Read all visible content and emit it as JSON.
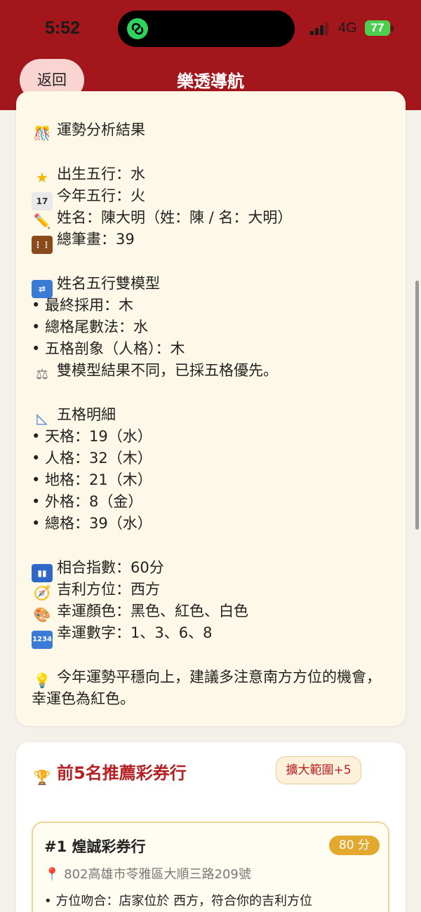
{
  "status": {
    "time": "5:52",
    "network": "4G",
    "battery": "77"
  },
  "nav": {
    "back_label": "返回",
    "title": "樂透導航"
  },
  "fortune": {
    "heading": "運勢分析結果",
    "birth_element": "出生五行：水",
    "year_element": "今年五行：火",
    "name_line": "姓名：陳大明（姓：陳 / 名：大明）",
    "total_strokes": "總筆畫：39",
    "dual_model_heading": "姓名五行雙模型",
    "final_adopted": "• 最終採用：木",
    "tail_method": "• 總格尾數法：水",
    "five_grid_person": "• 五格剖象（人格）：木",
    "dual_note": "雙模型結果不同，已採五格優先。",
    "five_grid_heading": "五格明細",
    "grid_items": [
      "• 天格：19（水）",
      "• 人格：32（木）",
      "• 地格：21（木）",
      "• 外格：8（金）",
      "• 總格：39（水）"
    ],
    "match_index": "相合指數：60分",
    "lucky_direction": "吉利方位：西方",
    "lucky_colors": "幸運顏色：黑色、紅色、白色",
    "lucky_numbers": "幸運數字：1、3、6、8",
    "advice": "今年運勢平穩向上，建議多注意南方方位的機會，幸運色為紅色。"
  },
  "shops": {
    "title": "前5名推薦彩券行",
    "expand_label": "擴大範圍+5",
    "items": [
      {
        "name": "#1 煌誠彩券行",
        "score": "80 分",
        "address": "802高雄市苓雅區大順三路209號",
        "reason": "• 方位吻合：店家位於 西方，符合你的吉利方位"
      }
    ]
  },
  "colors": {
    "brand_red": "#a3161b",
    "card_cream": "#fdf8e7",
    "badge_gold": "#e2a92e"
  },
  "icons": [
    "confetti-icon",
    "star-icon",
    "calendar-icon",
    "pencil-icon",
    "abacus-icon",
    "shuffle-icon",
    "scale-icon",
    "triangle-ruler-icon",
    "bar-chart-icon",
    "compass-icon",
    "palette-icon",
    "numbers-icon",
    "lightbulb-icon",
    "trophy-icon",
    "pin-icon"
  ]
}
